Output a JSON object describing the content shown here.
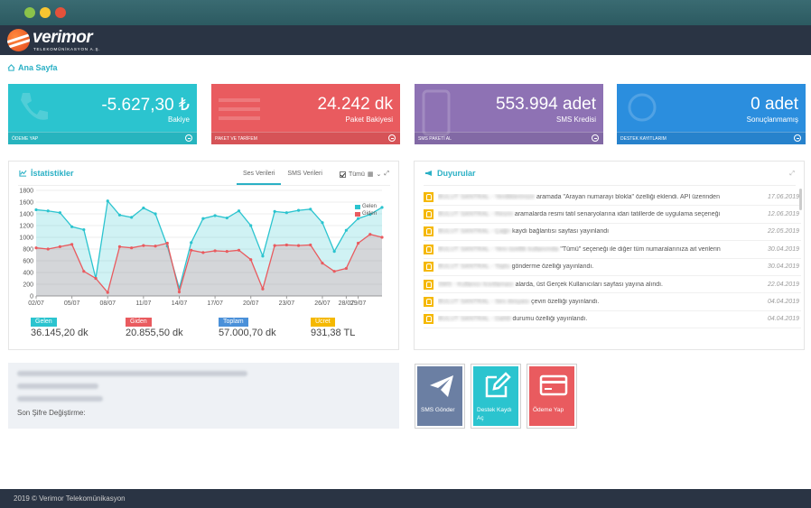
{
  "window": {
    "controls": [
      "green",
      "yellow",
      "red"
    ]
  },
  "brand": {
    "name": "verimor",
    "tagline": "TELEKOMÜNİKASYON A.Ş."
  },
  "breadcrumb": {
    "label": "Ana Sayfa",
    "icon": "home-icon"
  },
  "cards": [
    {
      "value": "-5.627,30 ₺",
      "label": "Bakiye",
      "footer": "ÖDEME YAP",
      "color": "#2bc4cf",
      "icon": "phone-icon"
    },
    {
      "value": "24.242 dk",
      "label": "Paket Bakiyesi",
      "footer": "PAKET VE TARİFEM",
      "color": "#e95b5f",
      "icon": "lines-icon"
    },
    {
      "value": "553.994 adet",
      "label": "SMS Kredisi",
      "footer": "SMS PAKETİ AL",
      "color": "#8e72b4",
      "icon": "mobile-icon"
    },
    {
      "value": "0 adet",
      "label": "Sonuçlanmamış",
      "footer": "DESTEK KAYITLARIM",
      "color": "#2b8ede",
      "icon": "support-icon"
    }
  ],
  "stats": {
    "title": "İstatistikler",
    "tabs": [
      "Ses Verileri",
      "SMS Verileri"
    ],
    "filter": "Tümü",
    "totals": [
      {
        "label": "Gelen",
        "value": "36.145,20 dk",
        "color": "#2bc4cf"
      },
      {
        "label": "Giden",
        "value": "20.855,50 dk",
        "color": "#e95b5f"
      },
      {
        "label": "Toplam",
        "value": "57.000,70 dk",
        "color": "#4a90d9"
      },
      {
        "label": "Ücret",
        "value": "931,38 TL",
        "color": "#f5b800"
      }
    ]
  },
  "chart_data": {
    "type": "area",
    "x": [
      "02/07",
      "03/07",
      "04/07",
      "05/07",
      "06/07",
      "07/07",
      "08/07",
      "09/07",
      "10/07",
      "11/07",
      "12/07",
      "13/07",
      "14/07",
      "15/07",
      "16/07",
      "17/07",
      "18/07",
      "19/07",
      "20/07",
      "21/07",
      "22/07",
      "23/07",
      "24/07",
      "25/07",
      "26/07",
      "27/07",
      "28/07",
      "29/07",
      "30/07",
      "31/07"
    ],
    "xticks": [
      "02/07",
      "05/07",
      "08/07",
      "11/07",
      "14/07",
      "17/07",
      "20/07",
      "23/07",
      "26/07",
      "28/07",
      "29/07"
    ],
    "ylim": [
      0,
      1800
    ],
    "yticks": [
      0,
      200,
      400,
      600,
      800,
      1000,
      1200,
      1400,
      1600,
      1800
    ],
    "series": [
      {
        "name": "Gelen",
        "color": "#2bc4cf",
        "values": [
          1470,
          1450,
          1420,
          1180,
          1130,
          300,
          1620,
          1380,
          1340,
          1500,
          1400,
          850,
          130,
          910,
          1320,
          1370,
          1330,
          1450,
          1200,
          680,
          1440,
          1420,
          1460,
          1480,
          1250,
          760,
          1120,
          1320,
          1390,
          1510
        ]
      },
      {
        "name": "Giden",
        "color": "#e95b5f",
        "values": [
          820,
          800,
          840,
          880,
          420,
          300,
          60,
          840,
          820,
          860,
          850,
          900,
          70,
          780,
          740,
          770,
          760,
          780,
          620,
          120,
          860,
          870,
          860,
          870,
          560,
          420,
          470,
          900,
          1050,
          1000
        ]
      }
    ],
    "legend": "top-right",
    "grid": true
  },
  "announcements": {
    "title": "Duyurular",
    "items": [
      {
        "hidden": "BULUT SANTRAL - Yeniliklerimize",
        "text": "aramada \"Arayan numarayı blokla\" özelliği eklendi. API üzerinden",
        "date": "17.06.2019"
      },
      {
        "hidden": "BULUT SANTRAL - Resmi",
        "text": "aramalarda resmi tatil senaryolarına idari tatillerde de uygulama seçeneği",
        "date": "12.06.2019"
      },
      {
        "hidden": "BULUT SANTRAL - Çağrı",
        "text": "kaydı bağlantısı sayfası yayınlandı",
        "date": "22.05.2019"
      },
      {
        "hidden": "BULUT SANTRAL - Yeni özellik kullanımda",
        "text": "\"Tümü\" seçeneği ile diğer tüm numaralarınıza ait verilerin",
        "date": "30.04.2019"
      },
      {
        "hidden": "BULUT SANTRAL - Toplu",
        "text": "gönderme özelliği yayınlandı.",
        "date": "30.04.2019"
      },
      {
        "hidden": "SMS - Kullanıcı kısıtlaması",
        "text": "alarda, üst Gerçek Kullanıcıları sayfası yayına alındı.",
        "date": "22.04.2019"
      },
      {
        "hidden": "BULUT SANTRAL - Ses dosyası",
        "text": "çeviri özelliği yayınlandı.",
        "date": "04.04.2019"
      },
      {
        "hidden": "BULUT SANTRAL - Dahili",
        "text": "durumu özelliği yayınlandı.",
        "date": "04.04.2019"
      }
    ]
  },
  "profile": {
    "change_password": "Son Şifre Değiştirme:"
  },
  "actions": [
    {
      "label": "SMS Gönder",
      "color": "#6b7fa3",
      "icon": "paper-plane-icon"
    },
    {
      "label": "Destek Kaydı Aç",
      "color": "#2bc4cf",
      "icon": "edit-icon"
    },
    {
      "label": "Ödeme Yap",
      "color": "#e95b5f",
      "icon": "credit-card-icon"
    }
  ],
  "footer": {
    "text": "2019 © Verimor Telekomünikasyon"
  }
}
